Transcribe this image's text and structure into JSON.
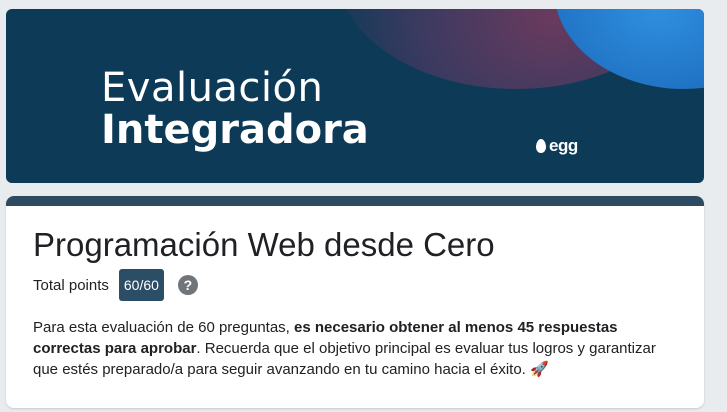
{
  "banner": {
    "title_line1": "Evaluación",
    "title_line2": "Integradora",
    "brand": "egg"
  },
  "form": {
    "title": "Programación Web desde Cero",
    "points_label": "Total points",
    "points_value": "60/60",
    "help_symbol": "?",
    "description": {
      "part1": "Para esta evaluación de 60 preguntas, ",
      "bold": "es necesario obtener al menos 45 respuestas correctas para aprobar",
      "part2": ". Recuerda que el objetivo principal es evaluar tus logros y garantizar que estés preparado/a para seguir avanzando en tu camino hacia el éxito. ",
      "emoji": "🚀"
    }
  },
  "colors": {
    "banner_bg": "#0d3a56",
    "accent": "#2d4a60",
    "badge_bg": "#2c4d66"
  }
}
